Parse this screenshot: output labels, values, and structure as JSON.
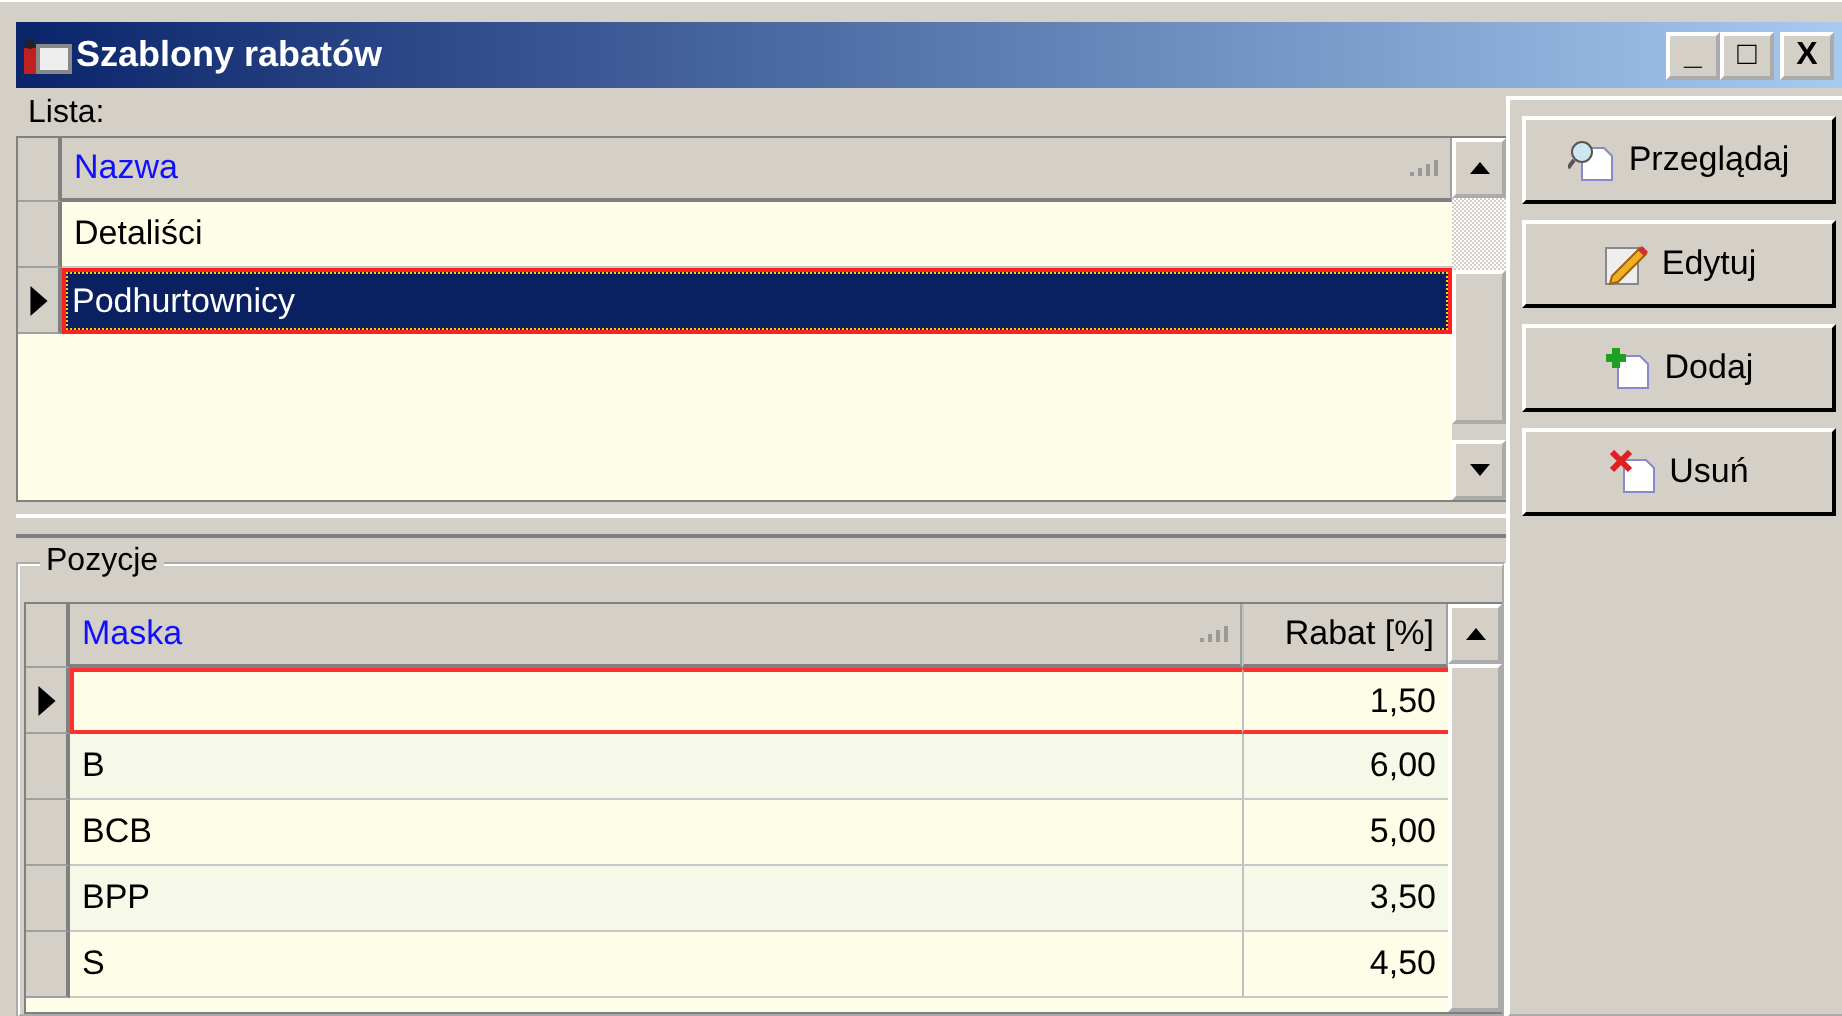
{
  "window": {
    "title": "Szablony rabatów",
    "controls": [
      "_",
      "□",
      "X"
    ]
  },
  "list": {
    "label": "Lista:",
    "column": "Nazwa",
    "rows": [
      {
        "name": "Detaliści",
        "selected": false
      },
      {
        "name": "Podhurtownicy",
        "selected": true
      }
    ]
  },
  "positions": {
    "label": "Pozycje",
    "columns": [
      "Maska",
      "Rabat [%]"
    ],
    "rows": [
      {
        "mask": "",
        "discount": "1,50",
        "selected": true
      },
      {
        "mask": "B",
        "discount": "6,00",
        "selected": false
      },
      {
        "mask": "BCB",
        "discount": "5,00",
        "selected": false
      },
      {
        "mask": "BPP",
        "discount": "3,50",
        "selected": false
      },
      {
        "mask": "S",
        "discount": "4,50",
        "selected": false
      }
    ]
  },
  "buttons": [
    {
      "label": "Przeglądaj",
      "kind": "view"
    },
    {
      "label": "Edytuj",
      "kind": "edit"
    },
    {
      "label": "Dodaj",
      "kind": "add"
    },
    {
      "label": "Usuń",
      "kind": "delete"
    }
  ]
}
